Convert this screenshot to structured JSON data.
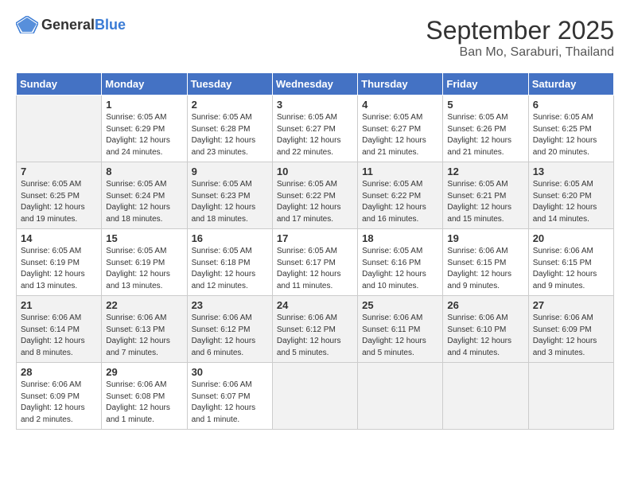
{
  "header": {
    "logo_general": "General",
    "logo_blue": "Blue",
    "month_title": "September 2025",
    "location": "Ban Mo, Saraburi, Thailand"
  },
  "days_of_week": [
    "Sunday",
    "Monday",
    "Tuesday",
    "Wednesday",
    "Thursday",
    "Friday",
    "Saturday"
  ],
  "weeks": [
    [
      {
        "day": "",
        "sunrise": "",
        "sunset": "",
        "daylight": ""
      },
      {
        "day": "1",
        "sunrise": "Sunrise: 6:05 AM",
        "sunset": "Sunset: 6:29 PM",
        "daylight": "Daylight: 12 hours and 24 minutes."
      },
      {
        "day": "2",
        "sunrise": "Sunrise: 6:05 AM",
        "sunset": "Sunset: 6:28 PM",
        "daylight": "Daylight: 12 hours and 23 minutes."
      },
      {
        "day": "3",
        "sunrise": "Sunrise: 6:05 AM",
        "sunset": "Sunset: 6:27 PM",
        "daylight": "Daylight: 12 hours and 22 minutes."
      },
      {
        "day": "4",
        "sunrise": "Sunrise: 6:05 AM",
        "sunset": "Sunset: 6:27 PM",
        "daylight": "Daylight: 12 hours and 21 minutes."
      },
      {
        "day": "5",
        "sunrise": "Sunrise: 6:05 AM",
        "sunset": "Sunset: 6:26 PM",
        "daylight": "Daylight: 12 hours and 21 minutes."
      },
      {
        "day": "6",
        "sunrise": "Sunrise: 6:05 AM",
        "sunset": "Sunset: 6:25 PM",
        "daylight": "Daylight: 12 hours and 20 minutes."
      }
    ],
    [
      {
        "day": "7",
        "sunrise": "Sunrise: 6:05 AM",
        "sunset": "Sunset: 6:25 PM",
        "daylight": "Daylight: 12 hours and 19 minutes."
      },
      {
        "day": "8",
        "sunrise": "Sunrise: 6:05 AM",
        "sunset": "Sunset: 6:24 PM",
        "daylight": "Daylight: 12 hours and 18 minutes."
      },
      {
        "day": "9",
        "sunrise": "Sunrise: 6:05 AM",
        "sunset": "Sunset: 6:23 PM",
        "daylight": "Daylight: 12 hours and 18 minutes."
      },
      {
        "day": "10",
        "sunrise": "Sunrise: 6:05 AM",
        "sunset": "Sunset: 6:22 PM",
        "daylight": "Daylight: 12 hours and 17 minutes."
      },
      {
        "day": "11",
        "sunrise": "Sunrise: 6:05 AM",
        "sunset": "Sunset: 6:22 PM",
        "daylight": "Daylight: 12 hours and 16 minutes."
      },
      {
        "day": "12",
        "sunrise": "Sunrise: 6:05 AM",
        "sunset": "Sunset: 6:21 PM",
        "daylight": "Daylight: 12 hours and 15 minutes."
      },
      {
        "day": "13",
        "sunrise": "Sunrise: 6:05 AM",
        "sunset": "Sunset: 6:20 PM",
        "daylight": "Daylight: 12 hours and 14 minutes."
      }
    ],
    [
      {
        "day": "14",
        "sunrise": "Sunrise: 6:05 AM",
        "sunset": "Sunset: 6:19 PM",
        "daylight": "Daylight: 12 hours and 13 minutes."
      },
      {
        "day": "15",
        "sunrise": "Sunrise: 6:05 AM",
        "sunset": "Sunset: 6:19 PM",
        "daylight": "Daylight: 12 hours and 13 minutes."
      },
      {
        "day": "16",
        "sunrise": "Sunrise: 6:05 AM",
        "sunset": "Sunset: 6:18 PM",
        "daylight": "Daylight: 12 hours and 12 minutes."
      },
      {
        "day": "17",
        "sunrise": "Sunrise: 6:05 AM",
        "sunset": "Sunset: 6:17 PM",
        "daylight": "Daylight: 12 hours and 11 minutes."
      },
      {
        "day": "18",
        "sunrise": "Sunrise: 6:05 AM",
        "sunset": "Sunset: 6:16 PM",
        "daylight": "Daylight: 12 hours and 10 minutes."
      },
      {
        "day": "19",
        "sunrise": "Sunrise: 6:06 AM",
        "sunset": "Sunset: 6:15 PM",
        "daylight": "Daylight: 12 hours and 9 minutes."
      },
      {
        "day": "20",
        "sunrise": "Sunrise: 6:06 AM",
        "sunset": "Sunset: 6:15 PM",
        "daylight": "Daylight: 12 hours and 9 minutes."
      }
    ],
    [
      {
        "day": "21",
        "sunrise": "Sunrise: 6:06 AM",
        "sunset": "Sunset: 6:14 PM",
        "daylight": "Daylight: 12 hours and 8 minutes."
      },
      {
        "day": "22",
        "sunrise": "Sunrise: 6:06 AM",
        "sunset": "Sunset: 6:13 PM",
        "daylight": "Daylight: 12 hours and 7 minutes."
      },
      {
        "day": "23",
        "sunrise": "Sunrise: 6:06 AM",
        "sunset": "Sunset: 6:12 PM",
        "daylight": "Daylight: 12 hours and 6 minutes."
      },
      {
        "day": "24",
        "sunrise": "Sunrise: 6:06 AM",
        "sunset": "Sunset: 6:12 PM",
        "daylight": "Daylight: 12 hours and 5 minutes."
      },
      {
        "day": "25",
        "sunrise": "Sunrise: 6:06 AM",
        "sunset": "Sunset: 6:11 PM",
        "daylight": "Daylight: 12 hours and 5 minutes."
      },
      {
        "day": "26",
        "sunrise": "Sunrise: 6:06 AM",
        "sunset": "Sunset: 6:10 PM",
        "daylight": "Daylight: 12 hours and 4 minutes."
      },
      {
        "day": "27",
        "sunrise": "Sunrise: 6:06 AM",
        "sunset": "Sunset: 6:09 PM",
        "daylight": "Daylight: 12 hours and 3 minutes."
      }
    ],
    [
      {
        "day": "28",
        "sunrise": "Sunrise: 6:06 AM",
        "sunset": "Sunset: 6:09 PM",
        "daylight": "Daylight: 12 hours and 2 minutes."
      },
      {
        "day": "29",
        "sunrise": "Sunrise: 6:06 AM",
        "sunset": "Sunset: 6:08 PM",
        "daylight": "Daylight: 12 hours and 1 minute."
      },
      {
        "day": "30",
        "sunrise": "Sunrise: 6:06 AM",
        "sunset": "Sunset: 6:07 PM",
        "daylight": "Daylight: 12 hours and 1 minute."
      },
      {
        "day": "",
        "sunrise": "",
        "sunset": "",
        "daylight": ""
      },
      {
        "day": "",
        "sunrise": "",
        "sunset": "",
        "daylight": ""
      },
      {
        "day": "",
        "sunrise": "",
        "sunset": "",
        "daylight": ""
      },
      {
        "day": "",
        "sunrise": "",
        "sunset": "",
        "daylight": ""
      }
    ]
  ]
}
